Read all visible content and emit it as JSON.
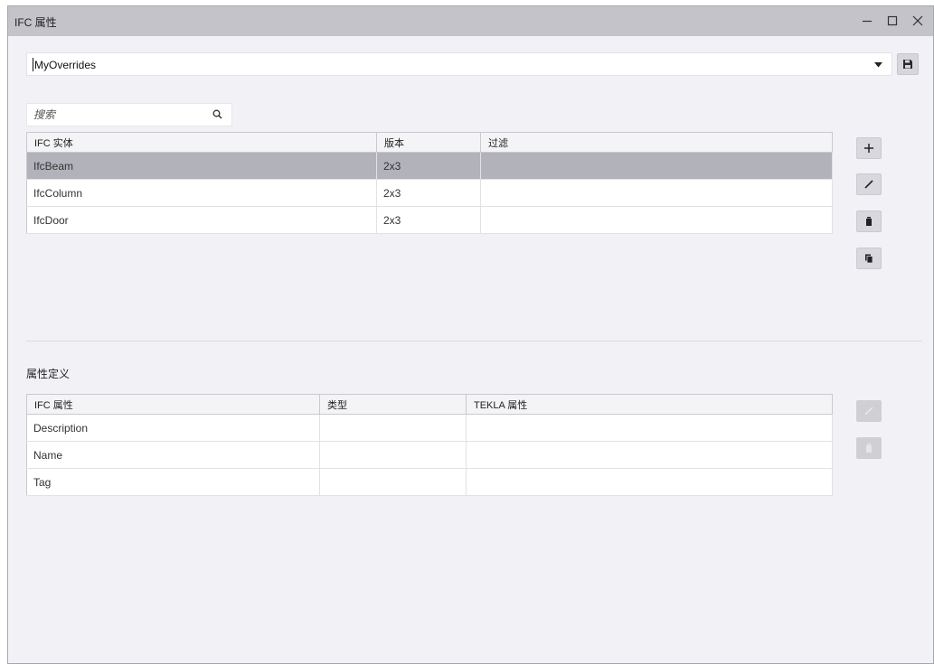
{
  "window": {
    "title": "IFC 属性",
    "minimize_icon": "minimize-icon",
    "maximize_icon": "maximize-icon",
    "close_icon": "close-icon"
  },
  "overrides": {
    "selected": "MyOverrides",
    "dropdown_icon": "chevron-down-icon",
    "save_icon": "floppy-disk-icon"
  },
  "search": {
    "placeholder": "搜索",
    "icon": "search-icon"
  },
  "entities": {
    "headers": [
      "IFC 实体",
      "版本",
      "过滤"
    ],
    "rows": [
      {
        "entity": "IfcBeam",
        "version": "2x3",
        "filter": "",
        "selected": true
      },
      {
        "entity": "IfcColumn",
        "version": "2x3",
        "filter": "",
        "selected": false
      },
      {
        "entity": "IfcDoor",
        "version": "2x3",
        "filter": "",
        "selected": false
      }
    ],
    "actions": [
      {
        "name": "add-entity-button",
        "icon": "plus-icon"
      },
      {
        "name": "edit-entity-button",
        "icon": "pencil-icon"
      },
      {
        "name": "delete-entity-button",
        "icon": "trash-icon"
      },
      {
        "name": "copy-entity-button",
        "icon": "copy-icon"
      }
    ]
  },
  "properties": {
    "section_label": "属性定义",
    "headers": [
      "IFC 属性",
      "类型",
      "TEKLA 属性"
    ],
    "rows": [
      {
        "ifc_property": "Description",
        "type": "",
        "tekla_property": ""
      },
      {
        "ifc_property": "Name",
        "type": "",
        "tekla_property": ""
      },
      {
        "ifc_property": "Tag",
        "type": "",
        "tekla_property": ""
      }
    ],
    "actions": [
      {
        "name": "edit-property-button",
        "icon": "pencil-icon",
        "enabled": false
      },
      {
        "name": "delete-property-button",
        "icon": "trash-icon",
        "enabled": false
      }
    ]
  },
  "colors": {
    "titlebar": "#c3c3c9",
    "window_bg": "#f2f1f6",
    "selected_row": "#b2b2ba",
    "button_bg": "#d8d8de"
  }
}
